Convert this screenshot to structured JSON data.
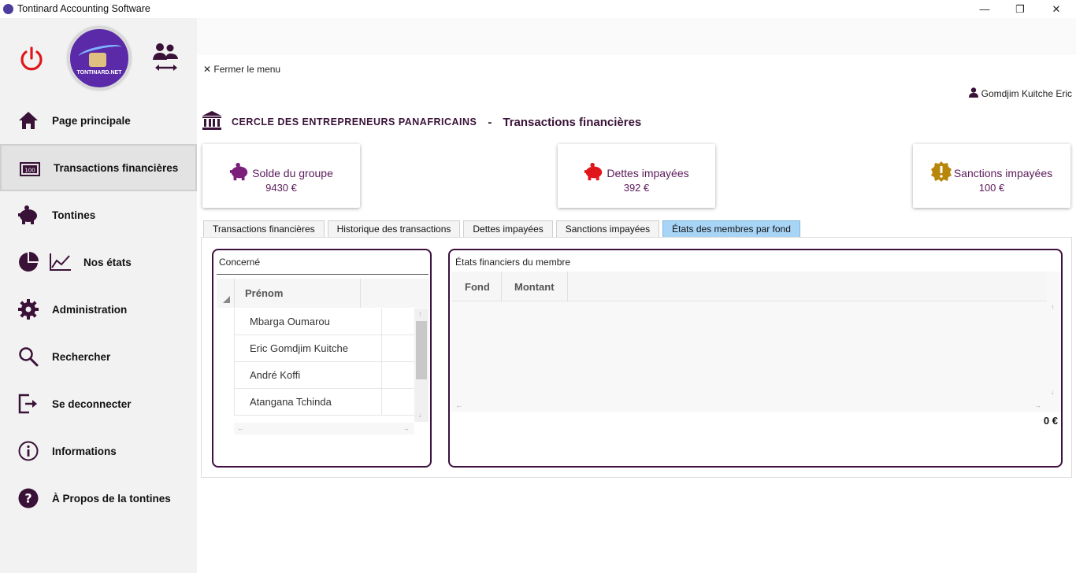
{
  "window": {
    "title": "Tontinard Accounting Software",
    "minimize": "—",
    "maximize": "❐",
    "close": "✕"
  },
  "logo": {
    "text": "TONTINARD.NET"
  },
  "sidebar": {
    "items": [
      {
        "label": "Page principale",
        "icon": "home-icon"
      },
      {
        "label": "Transactions financières",
        "icon": "cash-icon"
      },
      {
        "label": "Tontines",
        "icon": "piggy-bank-icon"
      },
      {
        "label": "Nos états",
        "icon": "chart-icon"
      },
      {
        "label": "Administration",
        "icon": "gear-icon"
      },
      {
        "label": "Rechercher",
        "icon": "search-icon"
      },
      {
        "label": "Se deconnecter",
        "icon": "logout-icon"
      },
      {
        "label": "Informations",
        "icon": "info-icon"
      },
      {
        "label": "À Propos de la  tontines",
        "icon": "help-icon"
      }
    ]
  },
  "main": {
    "close_menu": "Fermer le menu",
    "user_name": "Gomdjim Kuitche Eric",
    "organization": "CERCLE DES ENTREPRENEURS PANAFRICAINS",
    "separator": "-",
    "page_title": "Transactions financières"
  },
  "cards": [
    {
      "title": "Solde du groupe",
      "value": "9430 €",
      "icon_color": "#7a1f7a"
    },
    {
      "title": "Dettes impayées",
      "value": "392 €",
      "icon_color": "#e0161b"
    },
    {
      "title": "Sanctions impayées",
      "value": "100 €",
      "icon_color": "#b8860b"
    }
  ],
  "tabs": [
    {
      "label": "Transactions financières"
    },
    {
      "label": "Historique des transactions"
    },
    {
      "label": "Dettes impayées"
    },
    {
      "label": "Sanctions impayées"
    },
    {
      "label": "États des membres par fond",
      "active": true
    }
  ],
  "left_panel": {
    "title": "Concerné",
    "column": "Prénom",
    "rows": [
      "Mbarga Oumarou",
      "Eric Gomdjim Kuitche",
      "André Koffi",
      "Atangana Tchinda"
    ]
  },
  "right_panel": {
    "title": "États financiers du membre",
    "columns": [
      "Fond",
      "Montant"
    ],
    "total": "0 €"
  },
  "colors": {
    "accent": "#3f0f3f",
    "active_tab": "#a8d4f5",
    "power": "#e0161b"
  }
}
